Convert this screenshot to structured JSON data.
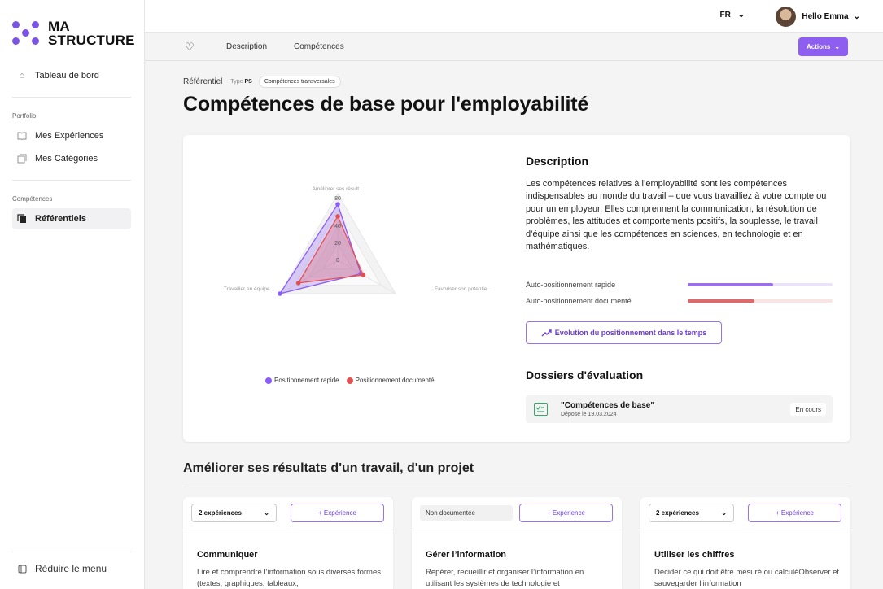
{
  "brand": {
    "line1": "MA",
    "line2": "STRUCTURE",
    "color": "#7b54e3"
  },
  "sidebar": {
    "dashboard": "Tableau de bord",
    "portfolio_label": "Portfolio",
    "experiences": "Mes Expériences",
    "categories": "Mes Catégories",
    "competences_label": "Compétences",
    "referentiels": "Référentiels",
    "collapse": "Réduire le menu"
  },
  "topbar": {
    "lang": "FR",
    "user": "Hello Emma"
  },
  "tabs": {
    "description": "Description",
    "competences": "Compétences",
    "actions": "Actions"
  },
  "header": {
    "crumb": "Référentiel",
    "type_label": "Type",
    "type_value": "PS",
    "tag": "Compétences transversales",
    "title": "Compétences de base pour l'employabilité"
  },
  "chart_data": {
    "type": "radar",
    "axes": [
      "Améliorer ses résult...",
      "Favoriser son potentie...",
      "Travailler en équipe..."
    ],
    "ticks": [
      "80",
      "40",
      "20",
      "0"
    ],
    "series": [
      {
        "name": "Positionnement rapide",
        "color": "#8b5cf6",
        "values": [
          84,
          40,
          100
        ]
      },
      {
        "name": "Positionnement documenté",
        "color": "#e05252",
        "values": [
          66,
          44,
          68
        ]
      }
    ]
  },
  "description": {
    "title": "Description",
    "text": "Les compétences relatives à l’employabilité sont les compétences indispensables au monde du travail – que vous travailliez à votre compte ou pour un employeur. Elles comprennent la communication, la résolution de problèmes, les attitudes et comportements positifs, la souplesse, le travail d’équipe ainsi que les compétences en sciences, en technologie et en mathématiques."
  },
  "positioning": [
    {
      "label": "Auto-positionnement rapide",
      "fill": 0.59,
      "color": "#9b6fe6",
      "track": "#ebe3fa"
    },
    {
      "label": "Auto-positionnement documenté",
      "fill": 0.46,
      "color": "#d96b6b",
      "track": "#f9e4e4"
    }
  ],
  "evolution_button": "Evolution du positionnement dans le temps",
  "dossiers": {
    "title": "Dossiers d'évaluation",
    "name": "\"Compétences de base\"",
    "date": "Déposé le 19.03.2024",
    "status": "En cours"
  },
  "section": {
    "title": "Améliorer ses résultats d'un travail, d'un projet",
    "cards": [
      {
        "select": "2 expériences",
        "add": "+ Expérience",
        "name": "Communiquer",
        "desc": "Lire et comprendre l’information sous diverses formes (textes, graphiques, tableaux,"
      },
      {
        "select": "Non documentée",
        "add": "+ Expérience",
        "name": "Gérer l’information",
        "desc": "Repérer, recueillir et organiser l’information en utilisant les systèmes de technologie et"
      },
      {
        "select": "2 expériences",
        "add": "+ Expérience",
        "name": "Utiliser les chiffres",
        "desc": "Décider ce qui doit être mesuré ou calculéObserver et sauvegarder l’information"
      }
    ]
  }
}
